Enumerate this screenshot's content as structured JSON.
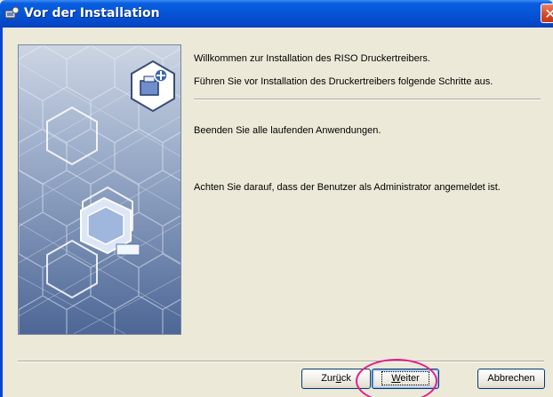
{
  "window": {
    "title": "Vor der Installation",
    "close_glyph": "✕",
    "title_icon": "setup-icon",
    "accent_color": "#0554d6"
  },
  "content": {
    "welcome": "Willkommen zur Installation des RISO Druckertreibers.",
    "instruction": "Führen Sie vor Installation des Druckertreibers folgende Schritte aus.",
    "step1": "Beenden Sie alle laufenden Anwendungen.",
    "step2": "Achten Sie darauf, dass der Benutzer als Administrator angemeldet ist."
  },
  "buttons": {
    "back": {
      "prefix": "Zur",
      "mnemonic": "ü",
      "suffix": "ck"
    },
    "next": {
      "mnemonic": "W",
      "suffix": "eiter"
    },
    "cancel": "Abbrechen"
  },
  "annotation": {
    "ring_color": "#e0218a"
  }
}
